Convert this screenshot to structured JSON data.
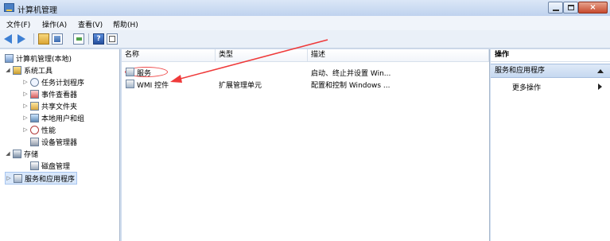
{
  "window": {
    "title": "计算机管理",
    "close_glyph": "×",
    "minimize_icon": "minimize-icon",
    "maximize_icon": "maximize-icon"
  },
  "menu": {
    "items": [
      "文件(F)",
      "操作(A)",
      "查看(V)",
      "帮助(H)"
    ]
  },
  "toolbar": {
    "help_label": "?"
  },
  "tree": {
    "root": "计算机管理(本地)",
    "items": [
      {
        "label": "系统工具",
        "toggle": "◢"
      },
      {
        "label": "任务计划程序",
        "toggle": "▷"
      },
      {
        "label": "事件查看器",
        "toggle": "▷"
      },
      {
        "label": "共享文件夹",
        "toggle": "▷"
      },
      {
        "label": "本地用户和组",
        "toggle": "▷"
      },
      {
        "label": "性能",
        "toggle": "▷"
      },
      {
        "label": "设备管理器",
        "toggle": ""
      },
      {
        "label": "存储",
        "toggle": "◢"
      },
      {
        "label": "磁盘管理",
        "toggle": ""
      },
      {
        "label": "服务和应用程序",
        "toggle": "▷"
      }
    ]
  },
  "list": {
    "headers": [
      "名称",
      "类型",
      "描述"
    ],
    "rows": [
      {
        "name": "服务",
        "type": "",
        "description": "启动、终止并设置 Win..."
      },
      {
        "name": "WMI 控件",
        "type": "扩展管理单元",
        "description": "配置和控制 Windows ..."
      }
    ]
  },
  "actions": {
    "header": "操作",
    "group": "服务和应用程序",
    "items": [
      "更多操作"
    ]
  },
  "annotation": {
    "color": "#ef3a3a"
  }
}
